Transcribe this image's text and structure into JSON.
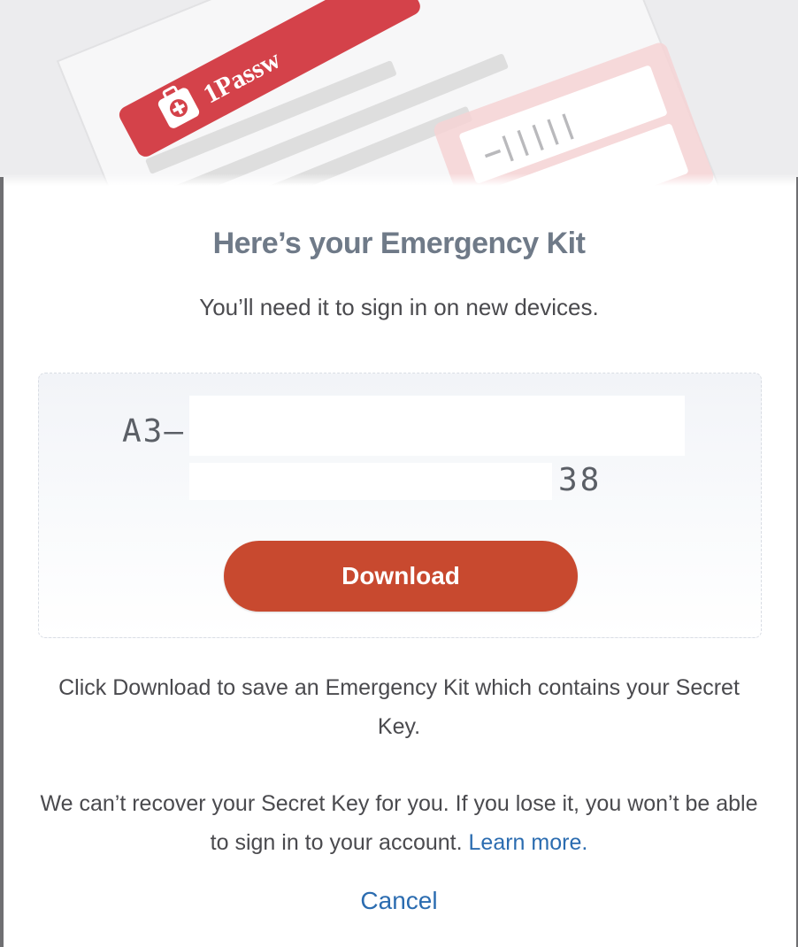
{
  "hero": {
    "brand_text": "1Passw",
    "barcode_text": "—‖‖‖‖",
    "icon": "first-aid-kit-icon"
  },
  "dialog": {
    "title": "Here’s your Emergency Kit",
    "subtitle": "You’ll need it to sign in on new devices."
  },
  "secret_key": {
    "prefix": "A3–",
    "suffix": "38"
  },
  "actions": {
    "download_label": "Download",
    "cancel_label": "Cancel"
  },
  "info": {
    "paragraph_1": "Click Download to save an Emergency Kit which contains your Secret Key.",
    "paragraph_2": "We can’t recover your Secret Key for you. If you lose it, you won’t be able to sign in to your account.",
    "learn_more": "Learn more."
  },
  "colors": {
    "primary_button": "#c8492f",
    "link": "#2b6cb0",
    "title": "#6f7a88",
    "kit_red": "#d4424a"
  }
}
